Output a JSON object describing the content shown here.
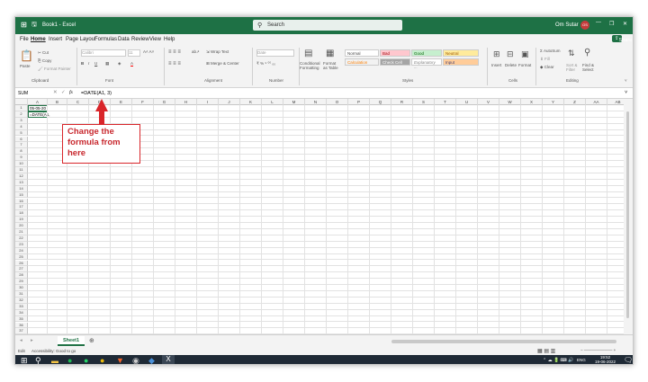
{
  "app": {
    "title": "Book1 - Excel",
    "search_placeholder": "Search",
    "user_name": "Om Sutar",
    "user_initials": "OS"
  },
  "ribbon_tabs": [
    "File",
    "Home",
    "Insert",
    "Page Layout",
    "Formulas",
    "Data",
    "Review",
    "View",
    "Help"
  ],
  "share_label": "Share",
  "clipboard": {
    "paste": "Paste",
    "cut": "Cut",
    "copy": "Copy",
    "format_painter": "Format Painter",
    "group": "Clipboard"
  },
  "font": {
    "name": "Calibri",
    "size": "11",
    "group": "Font"
  },
  "alignment": {
    "wrap": "Wrap Text",
    "merge": "Merge & Center",
    "group": "Alignment"
  },
  "number": {
    "format": "Date",
    "group": "Number"
  },
  "styles": {
    "conditional": "Conditional Formatting",
    "format_table": "Format as Table",
    "normal": "Normal",
    "bad": "Bad",
    "good": "Good",
    "neutral": "Neutral",
    "calculation": "Calculation",
    "check_cell": "Check Cell",
    "explanatory": "Explanatory ...",
    "input": "Input",
    "group": "Styles"
  },
  "cells": {
    "insert": "Insert",
    "delete": "Delete",
    "format": "Format",
    "group": "Cells"
  },
  "editing": {
    "autosum": "AutoSum",
    "fill": "Fill",
    "clear": "Clear",
    "sort": "Sort & Filter",
    "find": "Find & Select",
    "group": "Editing"
  },
  "formula_bar": {
    "name_box": "SUM",
    "fx": "fx",
    "formula": "=DATE(A1, 3)"
  },
  "columns": [
    "A",
    "B",
    "C",
    "D",
    "E",
    "F",
    "G",
    "H",
    "I",
    "J",
    "K",
    "L",
    "M",
    "N",
    "O",
    "P",
    "Q",
    "R",
    "S",
    "T",
    "U",
    "V",
    "W",
    "X",
    "Y",
    "Z",
    "AA",
    "AB"
  ],
  "rows": [
    "1",
    "2",
    "3",
    "4",
    "5",
    "6",
    "7",
    "8",
    "9",
    "10",
    "11",
    "12",
    "13",
    "14",
    "15",
    "16",
    "17",
    "18",
    "19",
    "20",
    "21",
    "22",
    "23",
    "24",
    "25",
    "26",
    "27",
    "28",
    "29",
    "30",
    "31",
    "32",
    "33",
    "34",
    "35",
    "36",
    "37"
  ],
  "cell_values": {
    "A1": "05-05-20",
    "A2": "=DATE(A1,"
  },
  "sheet_tab": "Sheet1",
  "status": {
    "mode": "Edit",
    "accessibility": "Accessibility: Good to go"
  },
  "taskbar": {
    "time": "19:52",
    "date": "19-06-2022",
    "lang": "ENG"
  },
  "annotation": {
    "line1": "Change the",
    "line2": "formula from",
    "line3": "here"
  },
  "colors": {
    "excel_green": "#1e7145",
    "callout_red": "#d9252a"
  }
}
